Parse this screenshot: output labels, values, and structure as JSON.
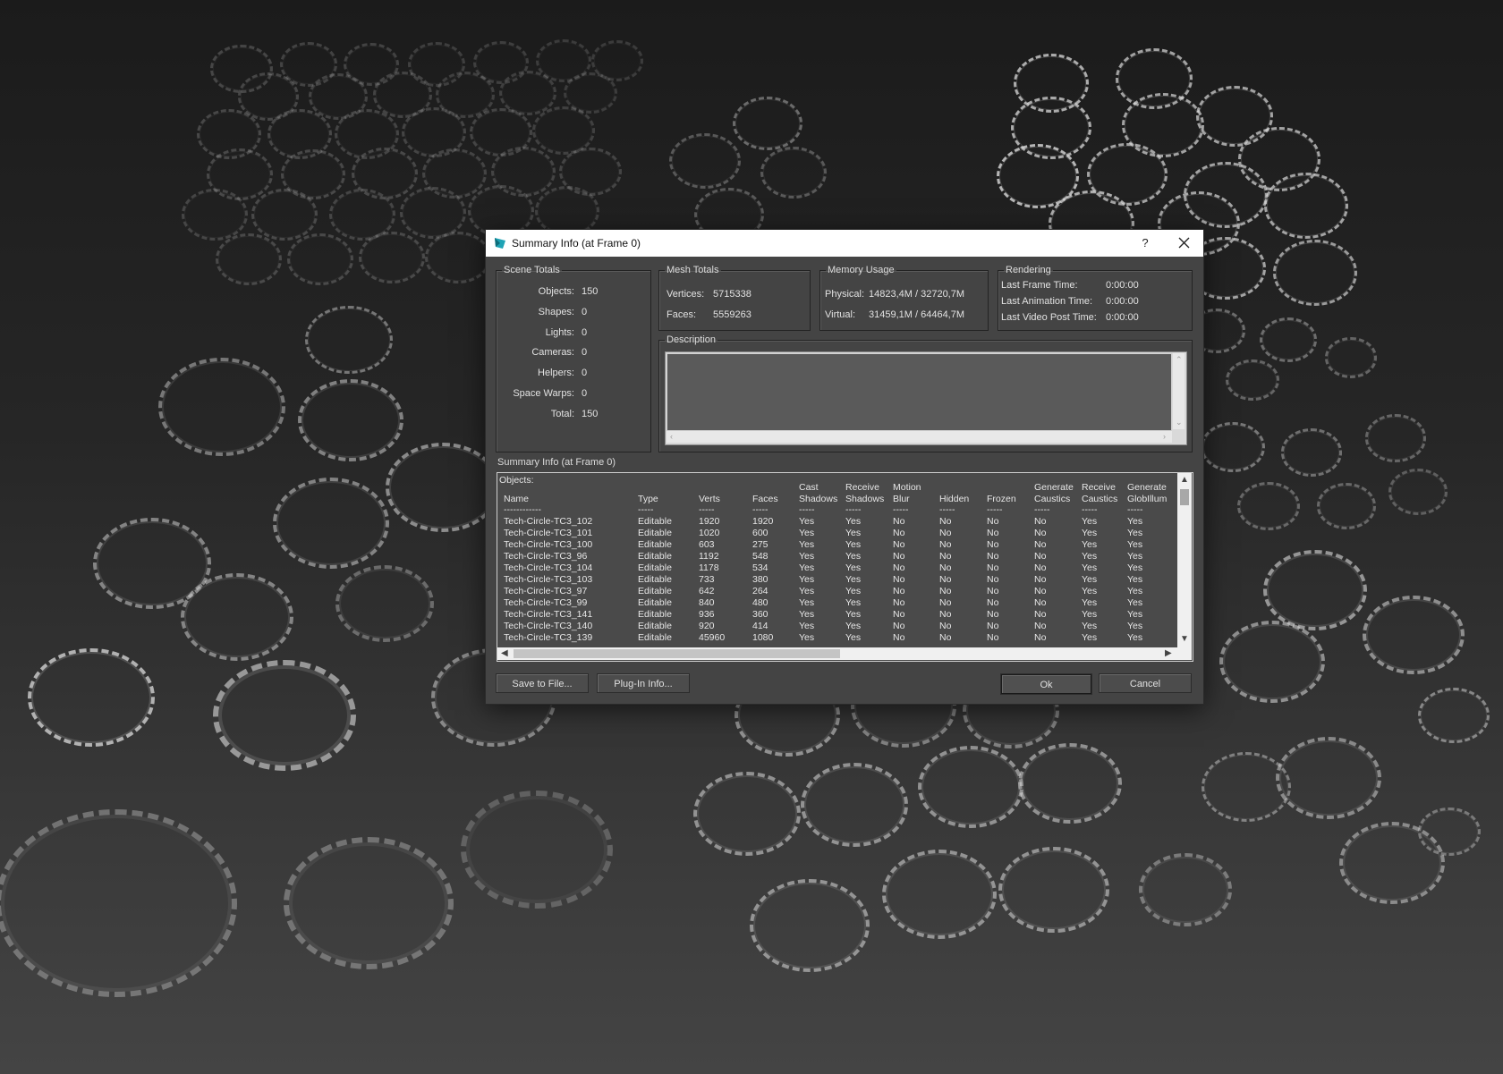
{
  "dialog": {
    "title": "Summary Info (at Frame 0)",
    "help_label": "?",
    "scene_totals": {
      "legend": "Scene Totals",
      "rows": [
        {
          "label": "Objects:",
          "value": "150"
        },
        {
          "label": "Shapes:",
          "value": "0"
        },
        {
          "label": "Lights:",
          "value": "0"
        },
        {
          "label": "Cameras:",
          "value": "0"
        },
        {
          "label": "Helpers:",
          "value": "0"
        },
        {
          "label": "Space Warps:",
          "value": "0"
        },
        {
          "label": "Total:",
          "value": "150"
        }
      ]
    },
    "mesh_totals": {
      "legend": "Mesh Totals",
      "rows": [
        {
          "label": "Vertices:",
          "value": "5715338"
        },
        {
          "label": "Faces:",
          "value": "5559263"
        }
      ]
    },
    "memory_usage": {
      "legend": "Memory Usage",
      "rows": [
        {
          "label": "Physical:",
          "value": "14823,4M / 32720,7M"
        },
        {
          "label": "Virtual:",
          "value": "31459,1M / 64464,7M"
        }
      ]
    },
    "rendering": {
      "legend": "Rendering",
      "rows": [
        {
          "label": "Last Frame Time:",
          "value": "0:00:00"
        },
        {
          "label": "Last Animation Time:",
          "value": "0:00:00"
        },
        {
          "label": "Last Video Post Time:",
          "value": "0:00:00"
        }
      ]
    },
    "description": {
      "legend": "Description",
      "value": ""
    },
    "list": {
      "title": "Summary Info (at Frame 0)",
      "objects_label": "Objects:",
      "columns": [
        {
          "line1": "",
          "line2": "Name",
          "sep": "------------"
        },
        {
          "line1": "",
          "line2": "Type",
          "sep": "-----"
        },
        {
          "line1": "",
          "line2": "Verts",
          "sep": "-----"
        },
        {
          "line1": "",
          "line2": "Faces",
          "sep": "-----"
        },
        {
          "line1": "Cast",
          "line2": "Shadows",
          "sep": "-----"
        },
        {
          "line1": "Receive",
          "line2": "Shadows",
          "sep": "-----"
        },
        {
          "line1": "Motion",
          "line2": "Blur",
          "sep": "-----"
        },
        {
          "line1": "",
          "line2": "Hidden",
          "sep": "-----"
        },
        {
          "line1": "",
          "line2": "Frozen",
          "sep": "-----"
        },
        {
          "line1": "Generate",
          "line2": "Caustics",
          "sep": "-----"
        },
        {
          "line1": "Receive",
          "line2": "Caustics",
          "sep": "-----"
        },
        {
          "line1": "Generate",
          "line2": "GlobIllum",
          "sep": "-----"
        }
      ],
      "rows": [
        [
          "Tech-Circle-TC3_102",
          "Editable",
          "1920",
          "1920",
          "Yes",
          "Yes",
          "No",
          "No",
          "No",
          "No",
          "Yes",
          "Yes"
        ],
        [
          "Tech-Circle-TC3_101",
          "Editable",
          "1020",
          "600",
          "Yes",
          "Yes",
          "No",
          "No",
          "No",
          "No",
          "Yes",
          "Yes"
        ],
        [
          "Tech-Circle-TC3_100",
          "Editable",
          "603",
          "275",
          "Yes",
          "Yes",
          "No",
          "No",
          "No",
          "No",
          "Yes",
          "Yes"
        ],
        [
          "Tech-Circle-TC3_96",
          "Editable",
          "1192",
          "548",
          "Yes",
          "Yes",
          "No",
          "No",
          "No",
          "No",
          "Yes",
          "Yes"
        ],
        [
          "Tech-Circle-TC3_104",
          "Editable",
          "1178",
          "534",
          "Yes",
          "Yes",
          "No",
          "No",
          "No",
          "No",
          "Yes",
          "Yes"
        ],
        [
          "Tech-Circle-TC3_103",
          "Editable",
          "733",
          "380",
          "Yes",
          "Yes",
          "No",
          "No",
          "No",
          "No",
          "Yes",
          "Yes"
        ],
        [
          "Tech-Circle-TC3_97",
          "Editable",
          "642",
          "264",
          "Yes",
          "Yes",
          "No",
          "No",
          "No",
          "No",
          "Yes",
          "Yes"
        ],
        [
          "Tech-Circle-TC3_99",
          "Editable",
          "840",
          "480",
          "Yes",
          "Yes",
          "No",
          "No",
          "No",
          "No",
          "Yes",
          "Yes"
        ],
        [
          "Tech-Circle-TC3_141",
          "Editable",
          "936",
          "360",
          "Yes",
          "Yes",
          "No",
          "No",
          "No",
          "No",
          "Yes",
          "Yes"
        ],
        [
          "Tech-Circle-TC3_140",
          "Editable",
          "920",
          "414",
          "Yes",
          "Yes",
          "No",
          "No",
          "No",
          "No",
          "Yes",
          "Yes"
        ],
        [
          "Tech-Circle-TC3_139",
          "Editable",
          "45960",
          "1080",
          "Yes",
          "Yes",
          "No",
          "No",
          "No",
          "No",
          "Yes",
          "Yes"
        ]
      ]
    },
    "buttons": {
      "save": "Save to File...",
      "plugin": "Plug-In Info...",
      "ok": "Ok",
      "cancel": "Cancel"
    }
  },
  "icons": {
    "app": "3dsmax-logo-icon",
    "close": "close-icon",
    "scroll_up": "scroll-up-arrow-icon",
    "scroll_down": "scroll-down-arrow-icon",
    "scroll_left": "scroll-left-arrow-icon",
    "scroll_right": "scroll-right-arrow-icon"
  },
  "colors": {
    "dialog_bg": "#444444",
    "titlebar_bg": "#ffffff",
    "app_icon": "#1fa3b5"
  }
}
